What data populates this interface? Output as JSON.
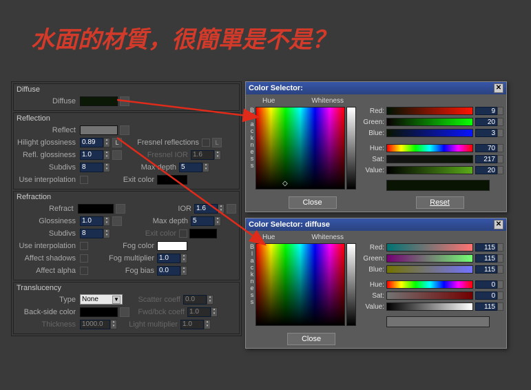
{
  "title_text": "水面的材質，很簡單是不是？",
  "material": {
    "diffuse": {
      "group": "Diffuse",
      "label": "Diffuse",
      "color": "#0a1805"
    },
    "reflection": {
      "group": "Reflection",
      "reflect_label": "Reflect",
      "reflect_color": "#737373",
      "hilight_gloss_label": "Hilight glossiness",
      "hilight_gloss": "0.89",
      "l_button": "L",
      "fresnel_label": "Fresnel reflections",
      "refl_gloss_label": "Refl. glossiness",
      "refl_gloss": "1.0",
      "fresnel_ior_label": "Fresnel IOR",
      "fresnel_ior": "1.6",
      "subdivs_label": "Subdivs",
      "subdivs": "8",
      "max_depth_label": "Max depth",
      "max_depth": "5",
      "use_interp_label": "Use interpolation",
      "exit_color_label": "Exit color",
      "exit_color": "#000000"
    },
    "refraction": {
      "group": "Refraction",
      "refract_label": "Refract",
      "refract_color": "#000000",
      "ior_label": "IOR",
      "ior": "1.6",
      "glossiness_label": "Glossiness",
      "glossiness": "1.0",
      "max_depth_label": "Max depth",
      "max_depth": "5",
      "subdivs_label": "Subdivs",
      "subdivs": "8",
      "exit_color_label": "Exit color",
      "exit_color": "#000000",
      "use_interp_label": "Use interpolation",
      "fog_color_label": "Fog color",
      "fog_color": "#ffffff",
      "affect_shadows_label": "Affect shadows",
      "fog_mult_label": "Fog multiplier",
      "fog_mult": "1.0",
      "affect_alpha_label": "Affect alpha",
      "fog_bias_label": "Fog bias",
      "fog_bias": "0.0"
    },
    "translucency": {
      "group": "Translucency",
      "type_label": "Type",
      "type_value": "None",
      "scatter_label": "Scatter coeff",
      "scatter": "0.0",
      "backside_label": "Back-side color",
      "backside_color": "#000000",
      "fwdbck_label": "Fwd/bck coeff",
      "fwdbck": "1.0",
      "thickness_label": "Thickness",
      "thickness": "1000.0",
      "lightmult_label": "Light multiplier",
      "lightmult": "1.0"
    }
  },
  "cs1": {
    "title": "Color Selector:",
    "hue_label": "Hue",
    "whiteness_label": "Whiteness",
    "blackness_label": "Blackness",
    "red_label": "Red:",
    "red": "9",
    "green_label": "Green:",
    "green": "20",
    "blue_label": "Blue:",
    "blue": "3",
    "hue_vlabel": "Hue:",
    "hue": "70",
    "sat_label": "Sat:",
    "sat": "217",
    "value_label": "Value:",
    "value": "20",
    "result_color": "#0a1403",
    "close": "Close",
    "reset": "Reset"
  },
  "cs2": {
    "title": "Color Selector: diffuse",
    "hue_label": "Hue",
    "whiteness_label": "Whiteness",
    "blackness_label": "Blackness",
    "red_label": "Red:",
    "red": "115",
    "green_label": "Green:",
    "green": "115",
    "blue_label": "Blue:",
    "blue": "115",
    "hue_vlabel": "Hue:",
    "hue": "0",
    "sat_label": "Sat:",
    "sat": "0",
    "value_label": "Value:",
    "value": "115",
    "result_color": "#737373",
    "close": "Close"
  }
}
